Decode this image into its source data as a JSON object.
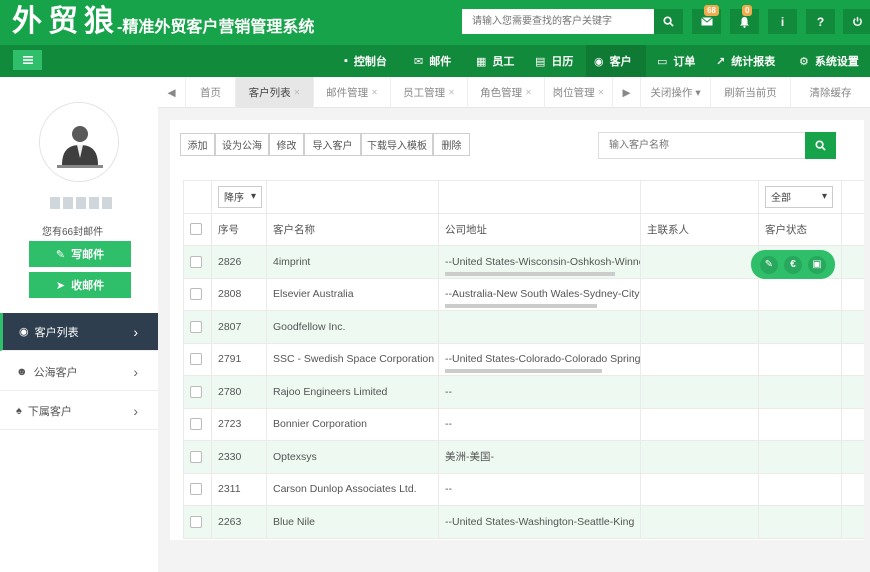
{
  "header": {
    "logo": "外贸狼",
    "subtitle": "-精准外贸客户营销管理系统",
    "search_placeholder": "请输入您需要查找的客户关键字",
    "mail_badge": "68",
    "bell_badge": "0",
    "info_label": "i",
    "help_label": "?"
  },
  "nav": {
    "items": [
      "控制台",
      "邮件",
      "员工",
      "日历",
      "客户",
      "订单",
      "统计报表",
      "系统设置"
    ]
  },
  "sidebar": {
    "mail_info": "您有66封邮件",
    "write_mail": "写邮件",
    "receive_mail": "收邮件",
    "items": [
      "客户列表",
      "公海客户",
      "下属客户"
    ]
  },
  "tabs": {
    "items": [
      "首页",
      "客户列表",
      "邮件管理",
      "员工管理",
      "角色管理",
      "岗位管理"
    ],
    "actions": [
      "关闭操作",
      "刷新当前页",
      "清除缓存"
    ]
  },
  "toolbar": {
    "buttons": [
      "添加",
      "设为公海",
      "修改",
      "导入客户",
      "下载导入模板",
      "删除"
    ],
    "search_placeholder": "输入客户名称"
  },
  "table": {
    "filter_left": "降序",
    "filter_right": "全部",
    "headers": [
      "序号",
      "客户名称",
      "公司地址",
      "主联系人",
      "客户状态"
    ],
    "rows": [
      {
        "id": "2826",
        "name": "4imprint",
        "address": "--United States-Wisconsin-Oshkosh-Winne"
      },
      {
        "id": "2808",
        "name": "Elsevier Australia",
        "address": "--Australia-New South Wales-Sydney-City"
      },
      {
        "id": "2807",
        "name": "Goodfellow Inc.",
        "address": ""
      },
      {
        "id": "2791",
        "name": "SSC - Swedish Space Corporation",
        "address": "--United States-Colorado-Colorado Springs"
      },
      {
        "id": "2780",
        "name": "Rajoo Engineers Limited",
        "address": "--"
      },
      {
        "id": "2723",
        "name": "Bonnier Corporation",
        "address": "--"
      },
      {
        "id": "2330",
        "name": "Optexsys",
        "address": "美洲-美国-"
      },
      {
        "id": "2311",
        "name": "Carson Dunlop Associates Ltd.",
        "address": "--"
      },
      {
        "id": "2263",
        "name": "Blue Nile",
        "address": "--United States-Washington-Seattle-King"
      }
    ]
  }
}
